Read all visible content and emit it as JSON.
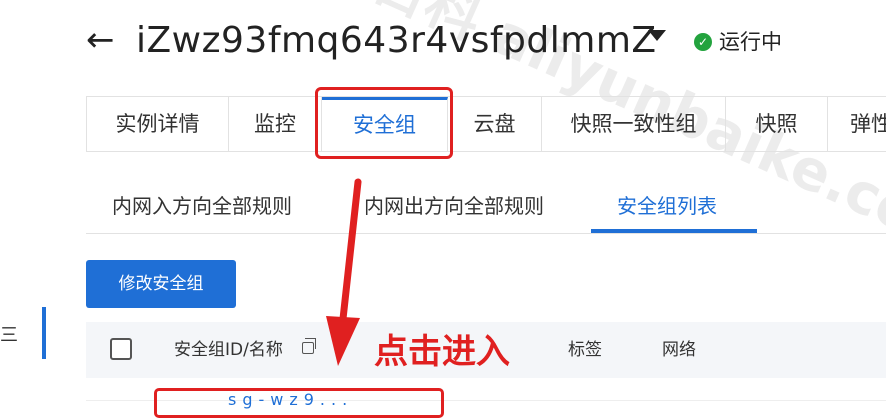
{
  "header": {
    "back_glyph": "←",
    "instance_id": "iZwz93fmq643r4vsfpdlmmZ",
    "status": "运行中",
    "status_color": "#23a33e"
  },
  "tabs": [
    {
      "label": "实例详情"
    },
    {
      "label": "监控"
    },
    {
      "label": "安全组",
      "active": true
    },
    {
      "label": "云盘"
    },
    {
      "label": "快照一致性组"
    },
    {
      "label": "快照"
    },
    {
      "label": "弹性"
    }
  ],
  "subtabs": [
    {
      "label": "内网入方向全部规则"
    },
    {
      "label": "内网出方向全部规则"
    },
    {
      "label": "安全组列表",
      "active": true
    }
  ],
  "actions": {
    "modify_label": "修改安全组"
  },
  "table": {
    "columns": [
      "安全组ID/名称",
      "标签",
      "网络"
    ],
    "partial_row_text": "sg-wz9..."
  },
  "annotation": {
    "text": "点击进入",
    "color": "#e02020"
  },
  "sidebar": {
    "glyph": "三"
  },
  "watermark": {
    "text": "阿里云百科 aliyunbaike.com"
  },
  "colors": {
    "accent": "#1f6fd6",
    "highlight": "#e02020"
  }
}
